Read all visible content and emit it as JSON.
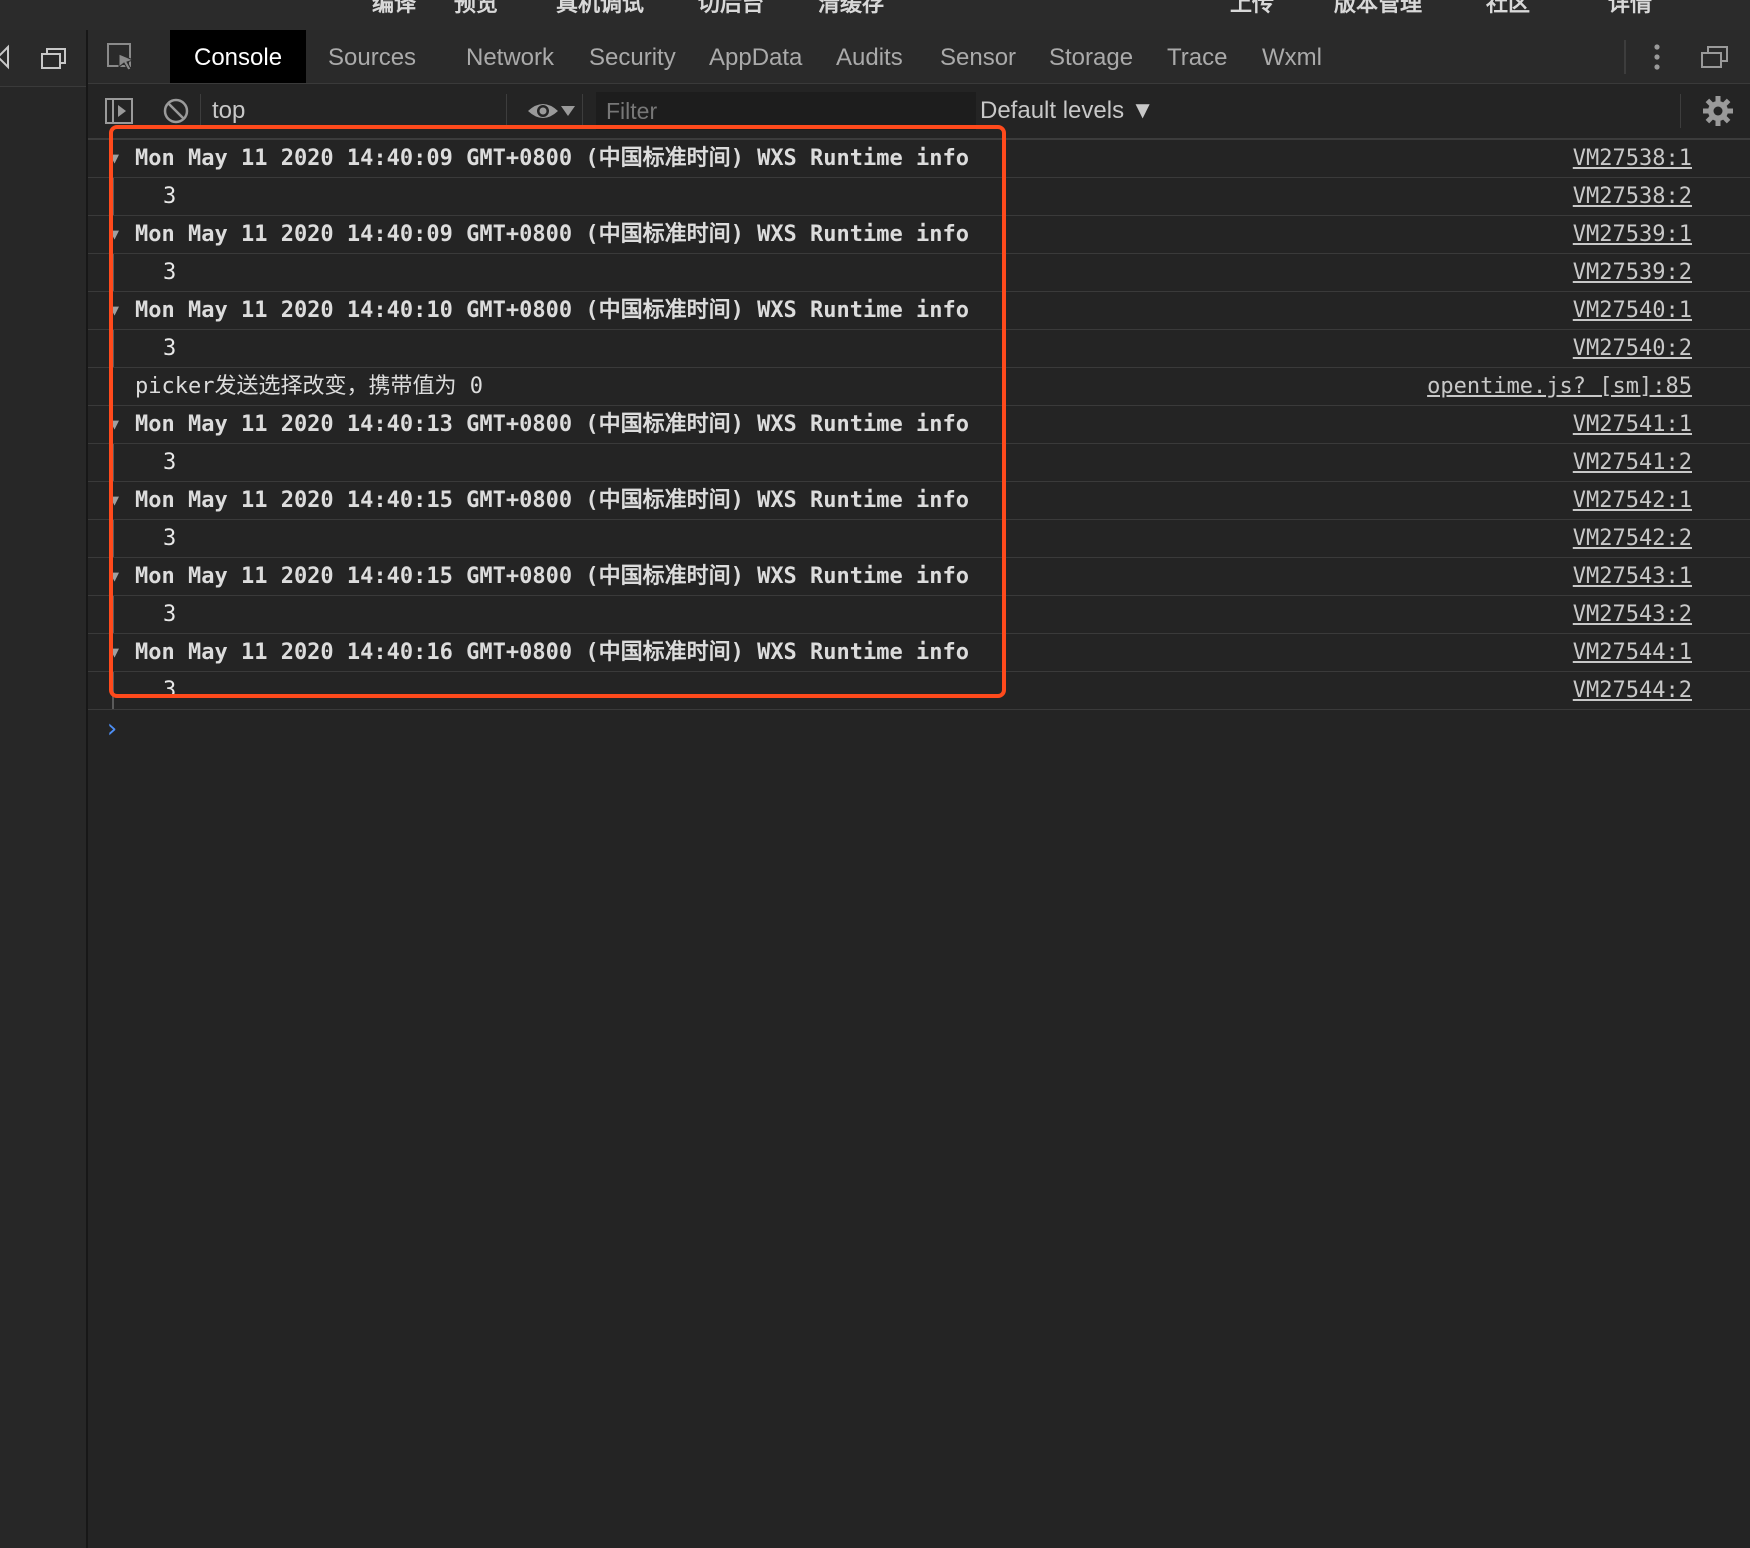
{
  "top_toolbar": {
    "items": [
      "编译",
      "预览",
      "真机调试",
      "切后台",
      "清缓存",
      "上传",
      "版本管理",
      "社区",
      "详情"
    ]
  },
  "devtools": {
    "tabs": [
      "Console",
      "Sources",
      "Network",
      "Security",
      "AppData",
      "Audits",
      "Sensor",
      "Storage",
      "Trace",
      "Wxml"
    ],
    "active_tab": "Console"
  },
  "console_toolbar": {
    "context": "top",
    "filter_placeholder": "Filter",
    "levels": "Default levels ▼"
  },
  "log": [
    {
      "type": "header",
      "text": "Mon May 11 2020 14:40:09 GMT+0800 (中国标准时间) WXS Runtime info",
      "source": "VM27538:1"
    },
    {
      "type": "value",
      "text": "3",
      "source": "VM27538:2"
    },
    {
      "type": "header",
      "text": "Mon May 11 2020 14:40:09 GMT+0800 (中国标准时间) WXS Runtime info",
      "source": "VM27539:1"
    },
    {
      "type": "value",
      "text": "3",
      "source": "VM27539:2"
    },
    {
      "type": "header",
      "text": "Mon May 11 2020 14:40:10 GMT+0800 (中国标准时间) WXS Runtime info",
      "source": "VM27540:1"
    },
    {
      "type": "value",
      "text": "3",
      "source": "VM27540:2"
    },
    {
      "type": "plain",
      "text": "picker发送选择改变，携带值为 0",
      "source": "opentime.js? [sm]:85"
    },
    {
      "type": "header",
      "text": "Mon May 11 2020 14:40:13 GMT+0800 (中国标准时间) WXS Runtime info",
      "source": "VM27541:1"
    },
    {
      "type": "value",
      "text": "3",
      "source": "VM27541:2"
    },
    {
      "type": "header",
      "text": "Mon May 11 2020 14:40:15 GMT+0800 (中国标准时间) WXS Runtime info",
      "source": "VM27542:1"
    },
    {
      "type": "value",
      "text": "3",
      "source": "VM27542:2"
    },
    {
      "type": "header",
      "text": "Mon May 11 2020 14:40:15 GMT+0800 (中国标准时间) WXS Runtime info",
      "source": "VM27543:1"
    },
    {
      "type": "value",
      "text": "3",
      "source": "VM27543:2"
    },
    {
      "type": "header",
      "text": "Mon May 11 2020 14:40:16 GMT+0800 (中国标准时间) WXS Runtime info",
      "source": "VM27544:1"
    },
    {
      "type": "value",
      "text": "3",
      "source": "VM27544:2"
    }
  ],
  "prompt_symbol": "›",
  "colors": {
    "highlight": "#ff4a1c",
    "prompt": "#4d8ff6",
    "background": "#242424"
  }
}
